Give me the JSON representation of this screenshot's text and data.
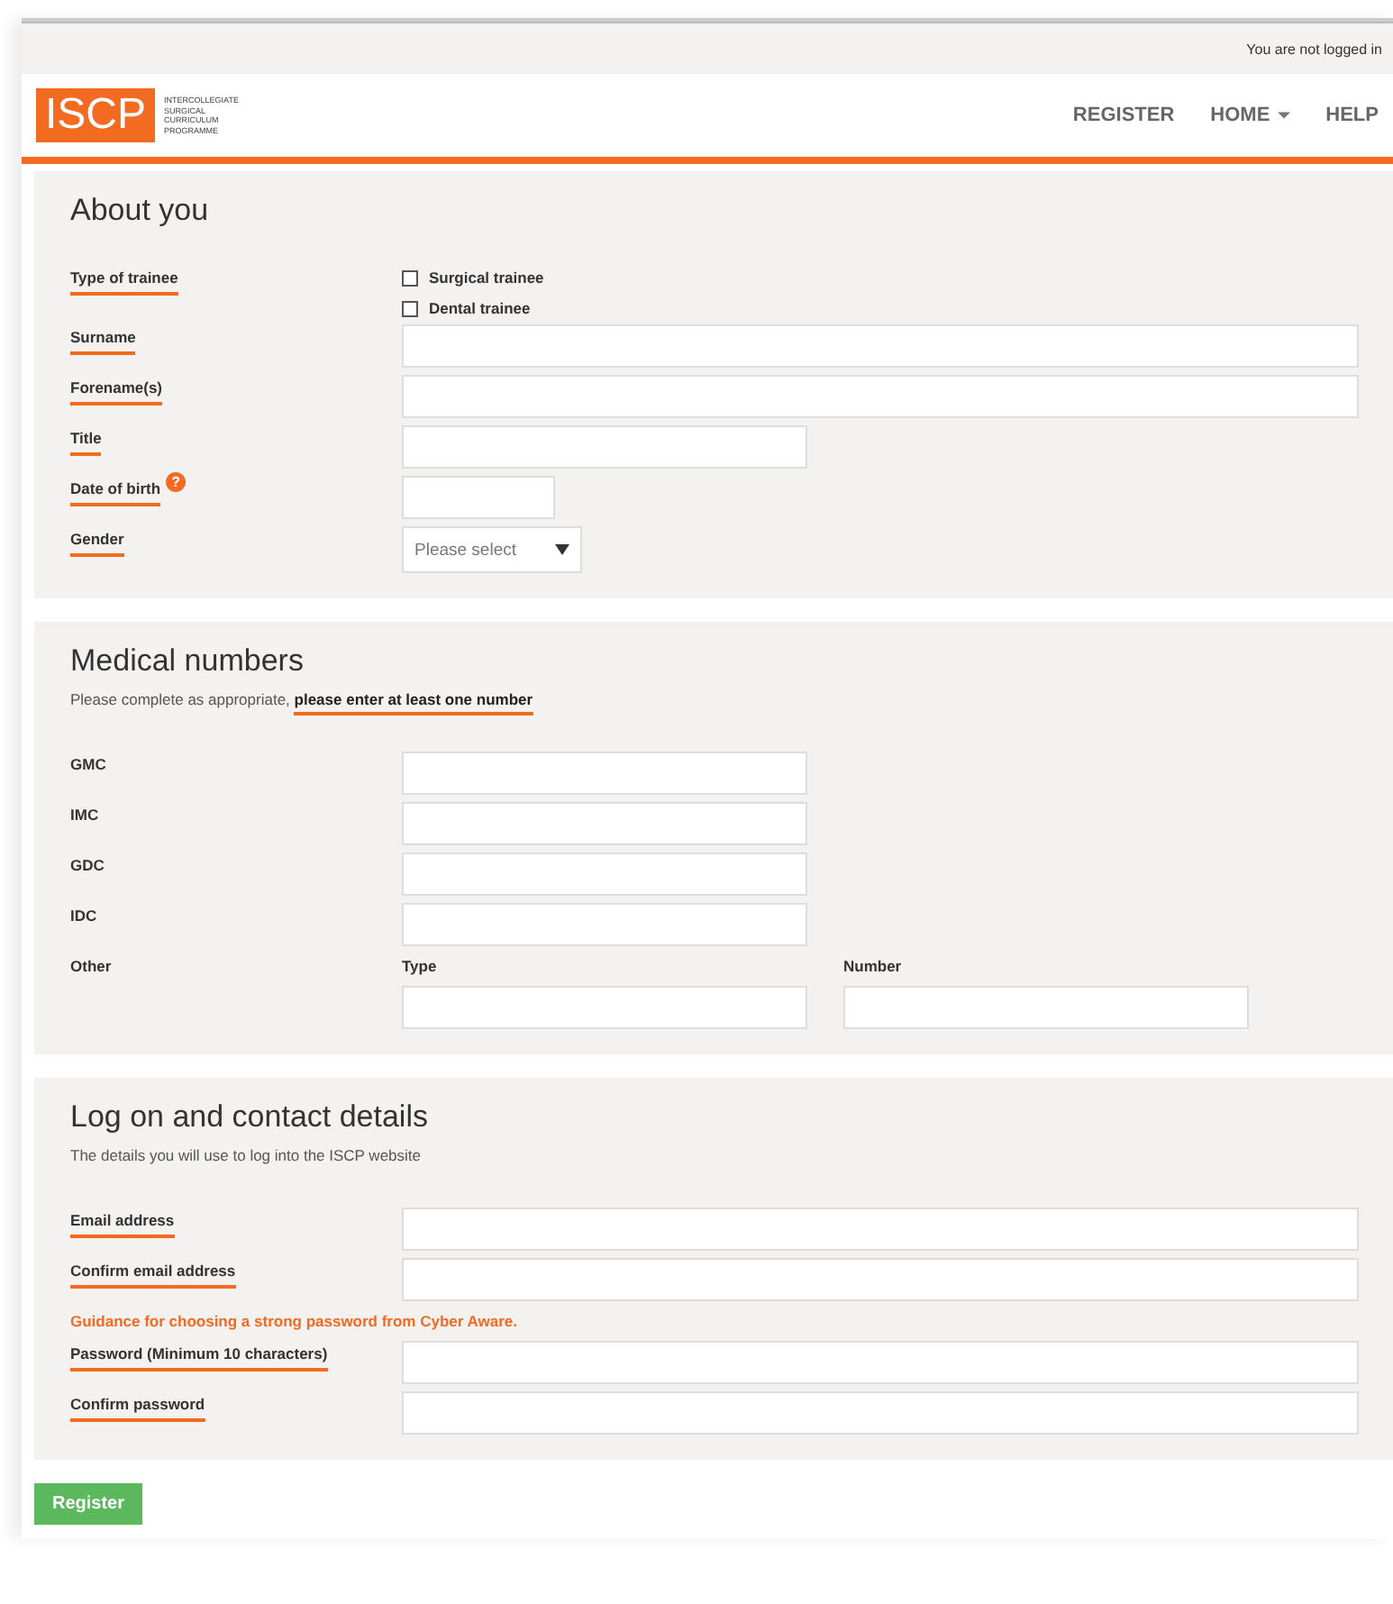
{
  "top_bar": {
    "login_status": "You are not logged in"
  },
  "header": {
    "logo": {
      "mark": "ISCP",
      "lines": [
        "INTERCOLLEGIATE",
        "SURGICAL",
        "CURRICULUM",
        "PROGRAMME"
      ]
    },
    "nav": [
      {
        "label": "REGISTER",
        "dropdown": false
      },
      {
        "label": "HOME",
        "dropdown": true
      },
      {
        "label": "HELP",
        "dropdown": false
      }
    ]
  },
  "sections": [
    {
      "title": "About you",
      "rows": [
        {
          "kind": "checkboxes",
          "label": "Type of trainee",
          "required": true,
          "options": [
            {
              "label": "Surgical trainee",
              "checked": false
            },
            {
              "label": "Dental trainee",
              "checked": false
            }
          ]
        },
        {
          "kind": "wide",
          "label": "Surname",
          "required": true
        },
        {
          "kind": "wide",
          "label": "Forename(s)",
          "required": true
        },
        {
          "kind": "medium",
          "label": "Title",
          "required": true
        },
        {
          "kind": "short",
          "label": "Date of birth",
          "required": true,
          "help": "?"
        },
        {
          "kind": "select",
          "label": "Gender",
          "required": true,
          "placeholder": "Please select"
        }
      ]
    },
    {
      "title": "Medical numbers",
      "intro": "Please complete as appropriate, ",
      "intro_emphasis": "please enter at least one number",
      "rows": [
        {
          "kind": "medium",
          "label": "GMC",
          "required": false
        },
        {
          "kind": "medium",
          "label": "IMC",
          "required": false
        },
        {
          "kind": "medium",
          "label": "GDC",
          "required": false
        },
        {
          "kind": "medium",
          "label": "IDC",
          "required": false
        },
        {
          "kind": "pair",
          "label": "Other",
          "required": false,
          "sublabels": [
            "Type",
            "Number"
          ]
        }
      ]
    },
    {
      "title": "Log on and contact details",
      "intro": "The details you will use to log into the ISCP website",
      "rows": [
        {
          "kind": "wide",
          "label": "Email address",
          "required": true
        },
        {
          "kind": "wide",
          "label": "Confirm email address",
          "required": true
        },
        {
          "kind": "link",
          "label": "Guidance for choosing a strong password from Cyber Aware."
        },
        {
          "kind": "wide",
          "label": "Password (Minimum 10 characters)",
          "required": true
        },
        {
          "kind": "wide",
          "label": "Confirm password",
          "required": true
        }
      ]
    }
  ],
  "submit": "Register"
}
